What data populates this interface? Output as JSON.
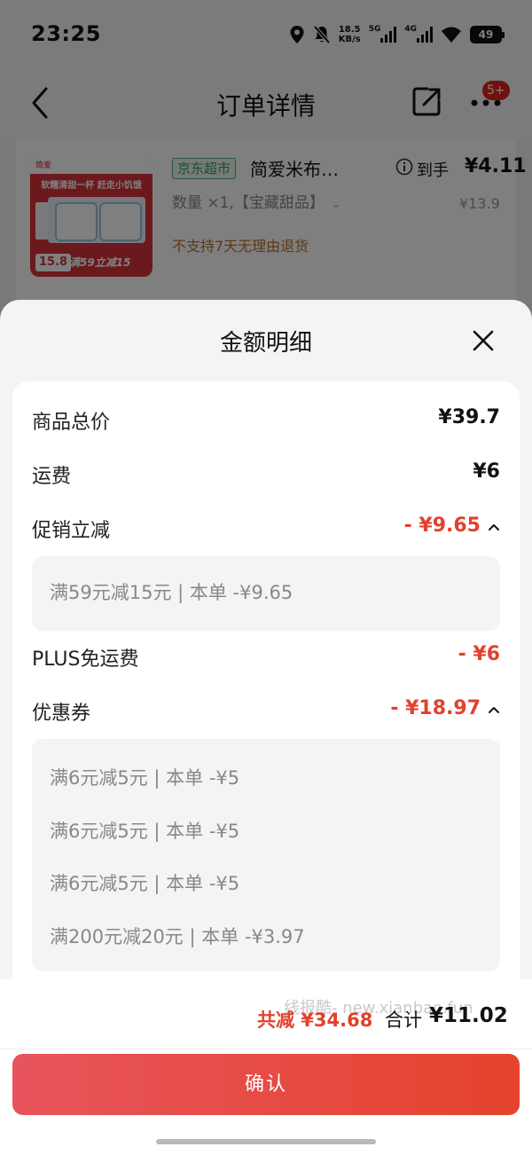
{
  "status_bar": {
    "time": "23:25",
    "net_speed_value": "18.5",
    "net_speed_unit": "KB/s",
    "sim1": "5G",
    "sim2": "4G",
    "battery": "49"
  },
  "nav": {
    "title": "订单详情",
    "badge": "5+"
  },
  "product": {
    "store_tag": "京东超市",
    "name": "简爱米布…",
    "price_label": "到手",
    "price_value": "¥4.11",
    "original_price": "¥13.9",
    "quantity": "数量 ×1,【宝藏甜品】",
    "notice": "不支持7天无理由退货",
    "image": {
      "top_text": "简爱",
      "headline": "软糯清甜一杯 赶走小饥饿",
      "price": "15.8",
      "promo": "满59立减15"
    }
  },
  "sheet": {
    "title": "金额明细",
    "rows": [
      {
        "label": "商品总价",
        "value": "¥39.7"
      },
      {
        "label": "运费",
        "value": "¥6"
      },
      {
        "label": "促销立减",
        "value": "- ¥9.65"
      },
      {
        "label": "PLUS免运费",
        "value": "- ¥6"
      },
      {
        "label": "优惠券",
        "value": "- ¥18.97"
      }
    ],
    "promo_details": [
      "满59元减15元 | 本单 -¥9.65"
    ],
    "coupon_details": [
      "满6元减5元 | 本单 -¥5",
      "满6元减5元 | 本单 -¥5",
      "满6元减5元 | 本单 -¥5",
      "满200元减20元 | 本单 -¥3.97"
    ]
  },
  "footer": {
    "watermark": "线报酷- new.xianbao.fun",
    "total_discount": "共减 ¥34.68",
    "total_label": "合计",
    "total_value": "¥11.02",
    "confirm_label": "确认"
  },
  "colors": {
    "accent_red": "#e2412d",
    "store_tag_green": "#3b9a62",
    "notice_orange": "#b8722a"
  }
}
